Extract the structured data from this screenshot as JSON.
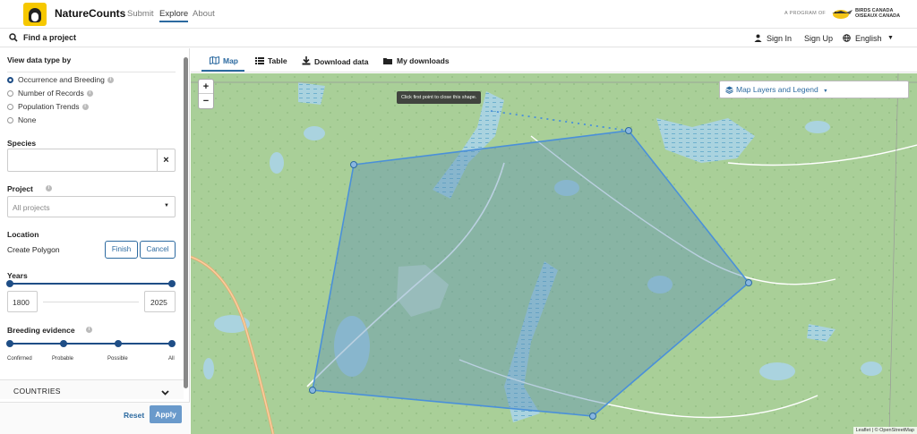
{
  "header": {
    "brand": "NatureCounts",
    "nav": [
      "Submit",
      "Explore",
      "About"
    ],
    "program_label": "A PROGRAM OF",
    "partner_line1": "BIRDS CANADA",
    "partner_line2": "OISEAUX CANADA"
  },
  "subheader": {
    "find_project": "Find a project",
    "sign_in": "Sign In",
    "sign_up": "Sign Up",
    "language": "English"
  },
  "sidebar": {
    "view_type_title": "View data type by",
    "view_options": [
      "Occurrence and Breeding",
      "Number of Records",
      "Population Trends",
      "None"
    ],
    "selected_view": "Occurrence and Breeding",
    "species_label": "Species",
    "species_value": "",
    "project_label": "Project",
    "project_value": "All projects",
    "location_label": "Location",
    "location_mode": "Create Polygon",
    "finish_label": "Finish",
    "cancel_label": "Cancel",
    "years_label": "Years",
    "year_start": "1800",
    "year_end": "2025",
    "breeding_label": "Breeding evidence",
    "breeding_ticks": [
      "Confirmed",
      "Probable",
      "Possible",
      "All"
    ],
    "countries_label": "COUNTRIES",
    "reset_label": "Reset",
    "apply_label": "Apply"
  },
  "tabs": {
    "items": [
      "Map",
      "Table",
      "Download data",
      "My downloads"
    ],
    "active": "Map"
  },
  "map": {
    "tooltip": "Click first point to close this shape.",
    "layers_button": "Map Layers and Legend",
    "zoom_in": "+",
    "zoom_out": "−",
    "attribution": "Leaflet | © OpenStreetMap",
    "colors": {
      "land": "#a9cf98",
      "water": "#aad3df",
      "polygon_fill": "#5b8fb6",
      "polygon_stroke": "#4a90d9",
      "accent": "#2c6aa0"
    }
  }
}
